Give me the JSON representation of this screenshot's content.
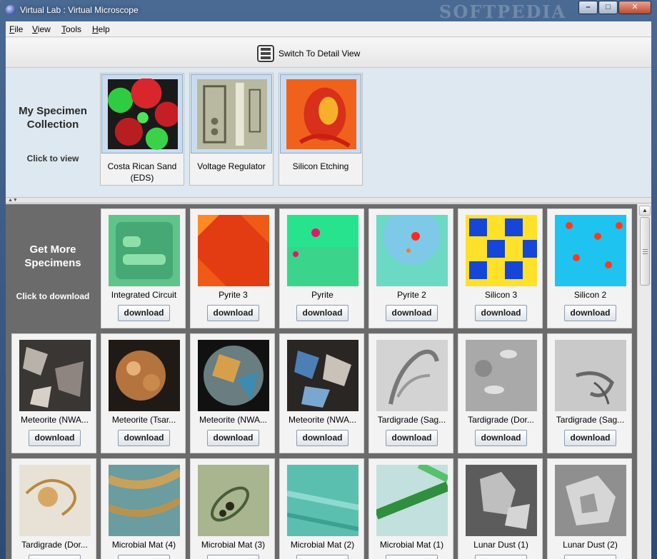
{
  "window": {
    "title": "Virtual Lab : Virtual Microscope",
    "watermark": "SOFTPEDIA",
    "buttons": {
      "minimize": "–",
      "maximize": "□",
      "close": "✕"
    }
  },
  "menu": [
    "File",
    "View",
    "Tools",
    "Help"
  ],
  "toolbar": {
    "switch_label": "Switch To Detail View",
    "switch_icon": "detail-view-icon"
  },
  "collection": {
    "heading_line1": "My Specimen",
    "heading_line2": "Collection",
    "subtitle": "Click to view",
    "items": [
      {
        "name_line1": "Costa Rican Sand",
        "name_line2": "(EDS)"
      },
      {
        "name_line1": "Voltage Regulator",
        "name_line2": ""
      },
      {
        "name_line1": "Silicon Etching",
        "name_line2": ""
      }
    ]
  },
  "download": {
    "heading_line1": "Get More",
    "heading_line2": "Specimens",
    "subtitle": "Click to download",
    "button_label": "download",
    "rows": [
      [
        "Integrated Circuit",
        "Pyrite 3",
        "Pyrite",
        "Pyrite 2",
        "Silicon 3",
        "Silicon 2"
      ],
      [
        "Meteorite (NWA...",
        "Meteorite (Tsar...",
        "Meteorite (NWA...",
        "Meteorite (NWA...",
        "Tardigrade (Sag...",
        "Tardigrade (Dor...",
        "Tardigrade (Sag..."
      ],
      [
        "Tardigrade (Dor...",
        "Microbial Mat (4)",
        "Microbial Mat (3)",
        "Microbial Mat (2)",
        "Microbial Mat (1)",
        "Lunar Dust (1)",
        "Lunar Dust (2)"
      ]
    ]
  }
}
